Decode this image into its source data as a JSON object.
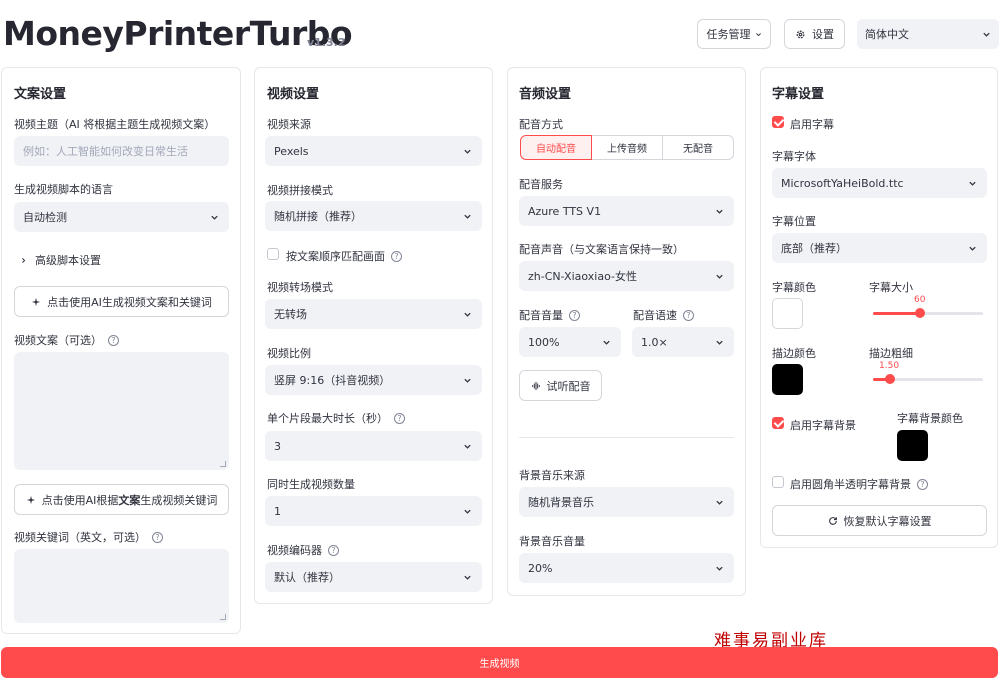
{
  "header": {
    "title": "MoneyPrinterTurbo",
    "version": "v1.3.2",
    "task_button": "任务管理",
    "settings_button": "设置",
    "language": "简体中文"
  },
  "script_panel": {
    "title": "文案设置",
    "subject_label": "视频主题（AI 将根据主题生成视频文案）",
    "subject_placeholder": "例如：人工智能如何改变日常生活",
    "language_label": "生成视频脚本的语言",
    "language_value": "自动检测",
    "advanced_label": "高级脚本设置",
    "gen_script_button": "点击使用AI生成视频文案和关键词",
    "script_label": "视频文案（可选）",
    "gen_keywords_pre": "点击使用AI根据",
    "gen_keywords_bold": "文案",
    "gen_keywords_post": "生成视频关键词",
    "keywords_label": "视频关键词（英文，可选）"
  },
  "video_panel": {
    "title": "视频设置",
    "source_label": "视频来源",
    "source_value": "Pexels",
    "concat_label": "视频拼接模式",
    "concat_value": "随机拼接（推荐）",
    "match_checkbox": "按文案顺序匹配画面",
    "match_checked": false,
    "transition_label": "视频转场模式",
    "transition_value": "无转场",
    "ratio_label": "视频比例",
    "ratio_value": "竖屏 9:16（抖音视频）",
    "clip_duration_label": "单个片段最大时长（秒）",
    "clip_duration_value": "3",
    "count_label": "同时生成视频数量",
    "count_value": "1",
    "codec_label": "视频编码器",
    "codec_value": "默认（推荐）"
  },
  "audio_panel": {
    "title": "音频设置",
    "mode_label": "配音方式",
    "modes": [
      "自动配音",
      "上传音频",
      "无配音"
    ],
    "service_label": "配音服务",
    "service_value": "Azure TTS V1",
    "voice_label": "配音声音（与文案语言保持一致）",
    "voice_value": "zh-CN-Xiaoxiao-女性",
    "volume_label": "配音音量",
    "volume_value": "100%",
    "rate_label": "配音语速",
    "rate_value": "1.0×",
    "preview_button": "试听配音",
    "bgm_source_label": "背景音乐来源",
    "bgm_source_value": "随机背景音乐",
    "bgm_volume_label": "背景音乐音量",
    "bgm_volume_value": "20%"
  },
  "subtitle_panel": {
    "title": "字幕设置",
    "enable_label": "启用字幕",
    "enable_checked": true,
    "font_label": "字幕字体",
    "font_value": "MicrosoftYaHeiBold.ttc",
    "position_label": "字幕位置",
    "position_value": "底部（推荐）",
    "color_label": "字幕颜色",
    "color_hex": "#ffffff",
    "size_label": "字幕大小",
    "size_value": "60",
    "size_fraction": 0.43,
    "stroke_color_label": "描边颜色",
    "stroke_color_hex": "#000000",
    "stroke_width_label": "描边粗细",
    "stroke_width_value": "1.50",
    "stroke_width_fraction": 0.15,
    "bg_enable_label": "启用字幕背景",
    "bg_enable_checked": true,
    "bg_color_label": "字幕背景颜色",
    "bg_color_hex": "#000000",
    "rounded_bg_label": "启用圆角半透明字幕背景",
    "rounded_bg_checked": false,
    "reset_button": "恢复默认字幕设置"
  },
  "generate_button": "生成视频",
  "watermark": "难事易副业库",
  "colors": {
    "accent": "#ff4b4b",
    "input_bg": "#f0f2f6"
  }
}
